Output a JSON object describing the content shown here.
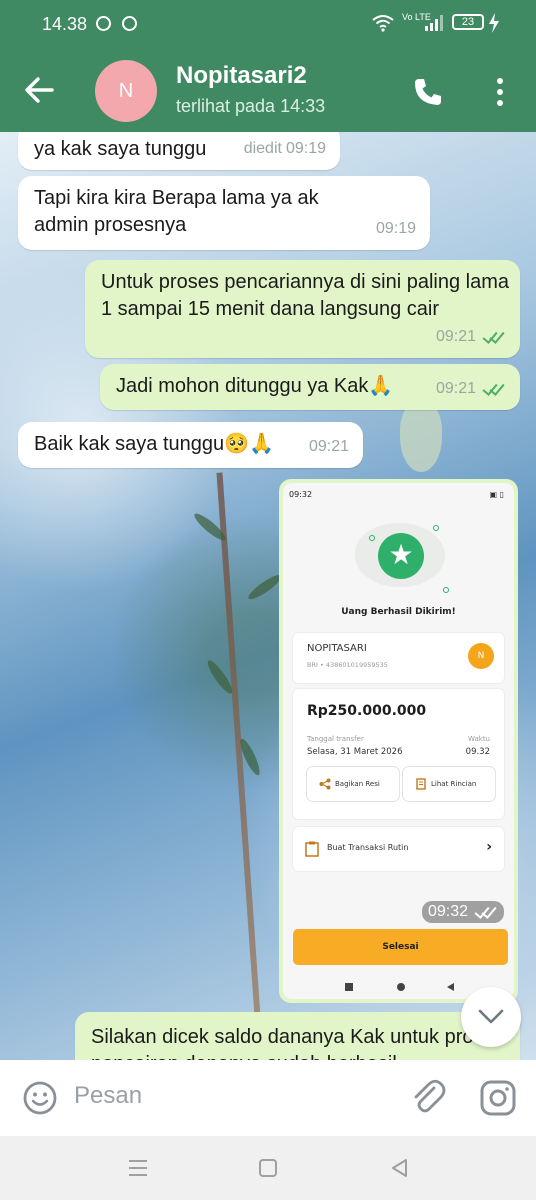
{
  "status_bar": {
    "time": "14.38",
    "network": "Vo LTE",
    "battery": "23"
  },
  "header": {
    "avatar_initial": "N",
    "contact_name": "Nopitasari2",
    "last_seen": "terlihat pada 14:33",
    "accent_color": "#3f8a63"
  },
  "messages": [
    {
      "direction": "in",
      "text": "ya kak saya tunggu",
      "edited": "diedit",
      "time": "09:19"
    },
    {
      "direction": "in",
      "text": "Tapi kira kira Berapa lama ya ak admin prosesnya",
      "time": "09:19"
    },
    {
      "direction": "out",
      "text": "Untuk proses pencariannya di sini paling lama 1 sampai 15 menit dana langsung cair",
      "time": "09:21"
    },
    {
      "direction": "out",
      "text": "Jadi mohon ditunggu ya Kak🙏",
      "time": "09:21"
    },
    {
      "direction": "in",
      "text": "Baik kak saya tunggu🥺🙏",
      "time": "09:21"
    },
    {
      "direction": "out",
      "text": "Silakan dicek saldo dananya Kak untuk proses pencairan dananya sudah berhasil"
    }
  ],
  "image_message": {
    "time": "09:32",
    "screenshot": {
      "status_time": "09:32",
      "title": "Uang Berhasil Dikirim!",
      "recipient_name": "NOPITASARI",
      "recipient_account": "BRI • 438601019959535",
      "recipient_initial": "N",
      "amount": "Rp250.000.000",
      "date_label": "Tanggal transfer",
      "date_value": "Selasa, 31 Maret 2026",
      "time_label": "Waktu",
      "time_value": "09.32",
      "share_label": "Bagikan Resi",
      "detail_label": "Lihat Rincian",
      "routine_label": "Buat Transaksi Rutin",
      "done_label": "Selesai"
    }
  },
  "input": {
    "placeholder": "Pesan"
  },
  "icons": {
    "back": "arrow-left-icon",
    "call": "phone-icon",
    "menu": "more-vertical-icon",
    "emoji": "emoji-icon",
    "attach": "paperclip-icon",
    "camera": "camera-icon",
    "scroll_down": "chevron-down-icon"
  }
}
